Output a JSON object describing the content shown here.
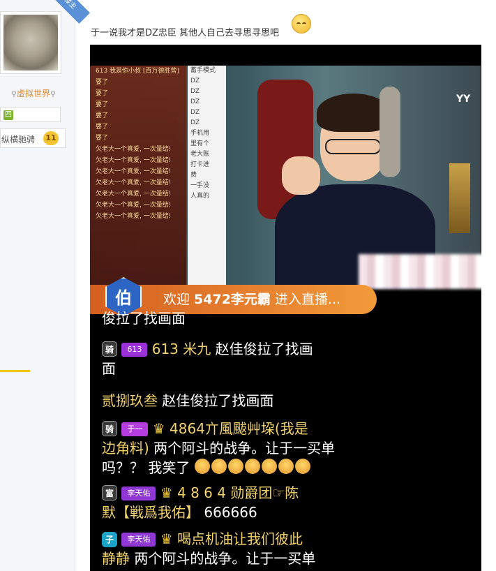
{
  "sidebar": {
    "badge": "楼主",
    "username": "虚拟世界",
    "rank_text": "纵横驰骋",
    "level": "11",
    "medal": "四"
  },
  "post": {
    "text": "于一说我才是DZ忠臣 其他人自己去寻思寻思吧"
  },
  "stream": {
    "left_lines": [
      "613 我是你小叔 [百万德胜营]",
      "要了",
      "要了",
      "要了",
      "要了",
      "要了",
      "要了",
      "欠老大一个真爱, 一次量结!",
      "欠老大一个真爱, 一次量结!",
      "欠老大一个真爱, 一次量结!",
      "欠老大一个真爱, 一次量结!",
      "欠老大一个真爱, 一次量结!",
      "欠老大一个真爱, 一次量结!",
      "欠老大一个真爱, 一次量结!"
    ],
    "mid_lines": [
      "蓄手模式",
      "DZ",
      "DZ",
      "DZ",
      "DZ",
      "DZ",
      "手机用",
      "里有个",
      "老大账",
      "打卡进",
      "费",
      "一手没",
      "人真的"
    ],
    "vv": "YY"
  },
  "welcome": {
    "prefix": "欢迎 ",
    "name": "5472李元霸",
    "suffix": " 进入直播...",
    "badge": "伯"
  },
  "chat": {
    "line1": "俊拉了找画面",
    "l2_rank": "骑",
    "l2_tag": "613",
    "l2_user": "613 米九",
    "l2_msg": " 赵佳俊拉了找画",
    "line3": "面",
    "l4_user": "贰捌玖叁",
    "l4_msg": " 赵佳俊拉了找画面",
    "l5_rank": "骑",
    "l5_tag": "于一",
    "l5_user": "4864亣風颰艸垜(我是",
    "l6_user": "边角料)",
    "l6_msg": " 两个阿斗的战争。让于一买单",
    "l7_msg": "吗？？ 我笑了",
    "l8_rank": "富",
    "l8_tag": "李天佑",
    "l8_user": "4 8 6 4 勋爵团☞陈",
    "l9_user": "默【戦爲我佑】",
    "l9_msg": " 666666",
    "l10_rank": "子",
    "l10_tag": "李天佑",
    "l10_user": "喝点机油让我们彼此",
    "l11_user": "静静",
    "l11_msg": " 两个阿斗的战争。让于一买单"
  },
  "colors": {
    "welcome_bg": "#e8732a",
    "badge_blue": "#2d65c4",
    "tag_purple": "#9a32d8",
    "user_gold": "#f3d36a"
  }
}
